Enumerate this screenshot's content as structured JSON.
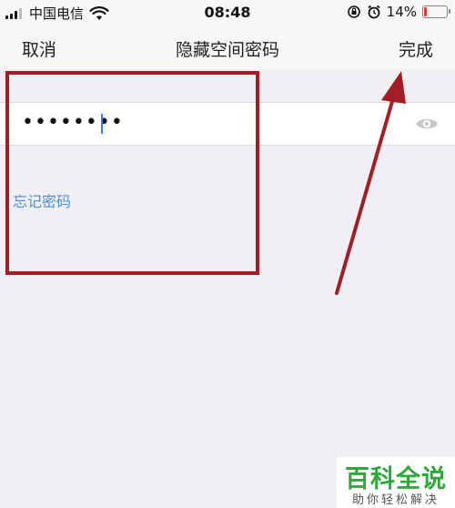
{
  "status_bar": {
    "carrier": "中国电信",
    "time": "08:48",
    "battery_percent": "14%",
    "battery_level": 0.14,
    "icons": [
      "signal-icon",
      "wifi-icon",
      "orientation-lock-icon",
      "alarm-icon",
      "battery-icon"
    ]
  },
  "nav": {
    "cancel_label": "取消",
    "title": "隐藏空间密码",
    "done_label": "完成"
  },
  "password": {
    "masked_value": "••••••••",
    "visibility_icon": "eye-icon"
  },
  "forgot_password_label": "忘记密码",
  "colors": {
    "annotation": "#a31d24",
    "link": "#4a90d9",
    "caret": "#2f7cf6",
    "watermark_green": "#2eaa3a"
  },
  "watermark": {
    "title": "百科全说",
    "subtitle": "助你轻松解决"
  }
}
